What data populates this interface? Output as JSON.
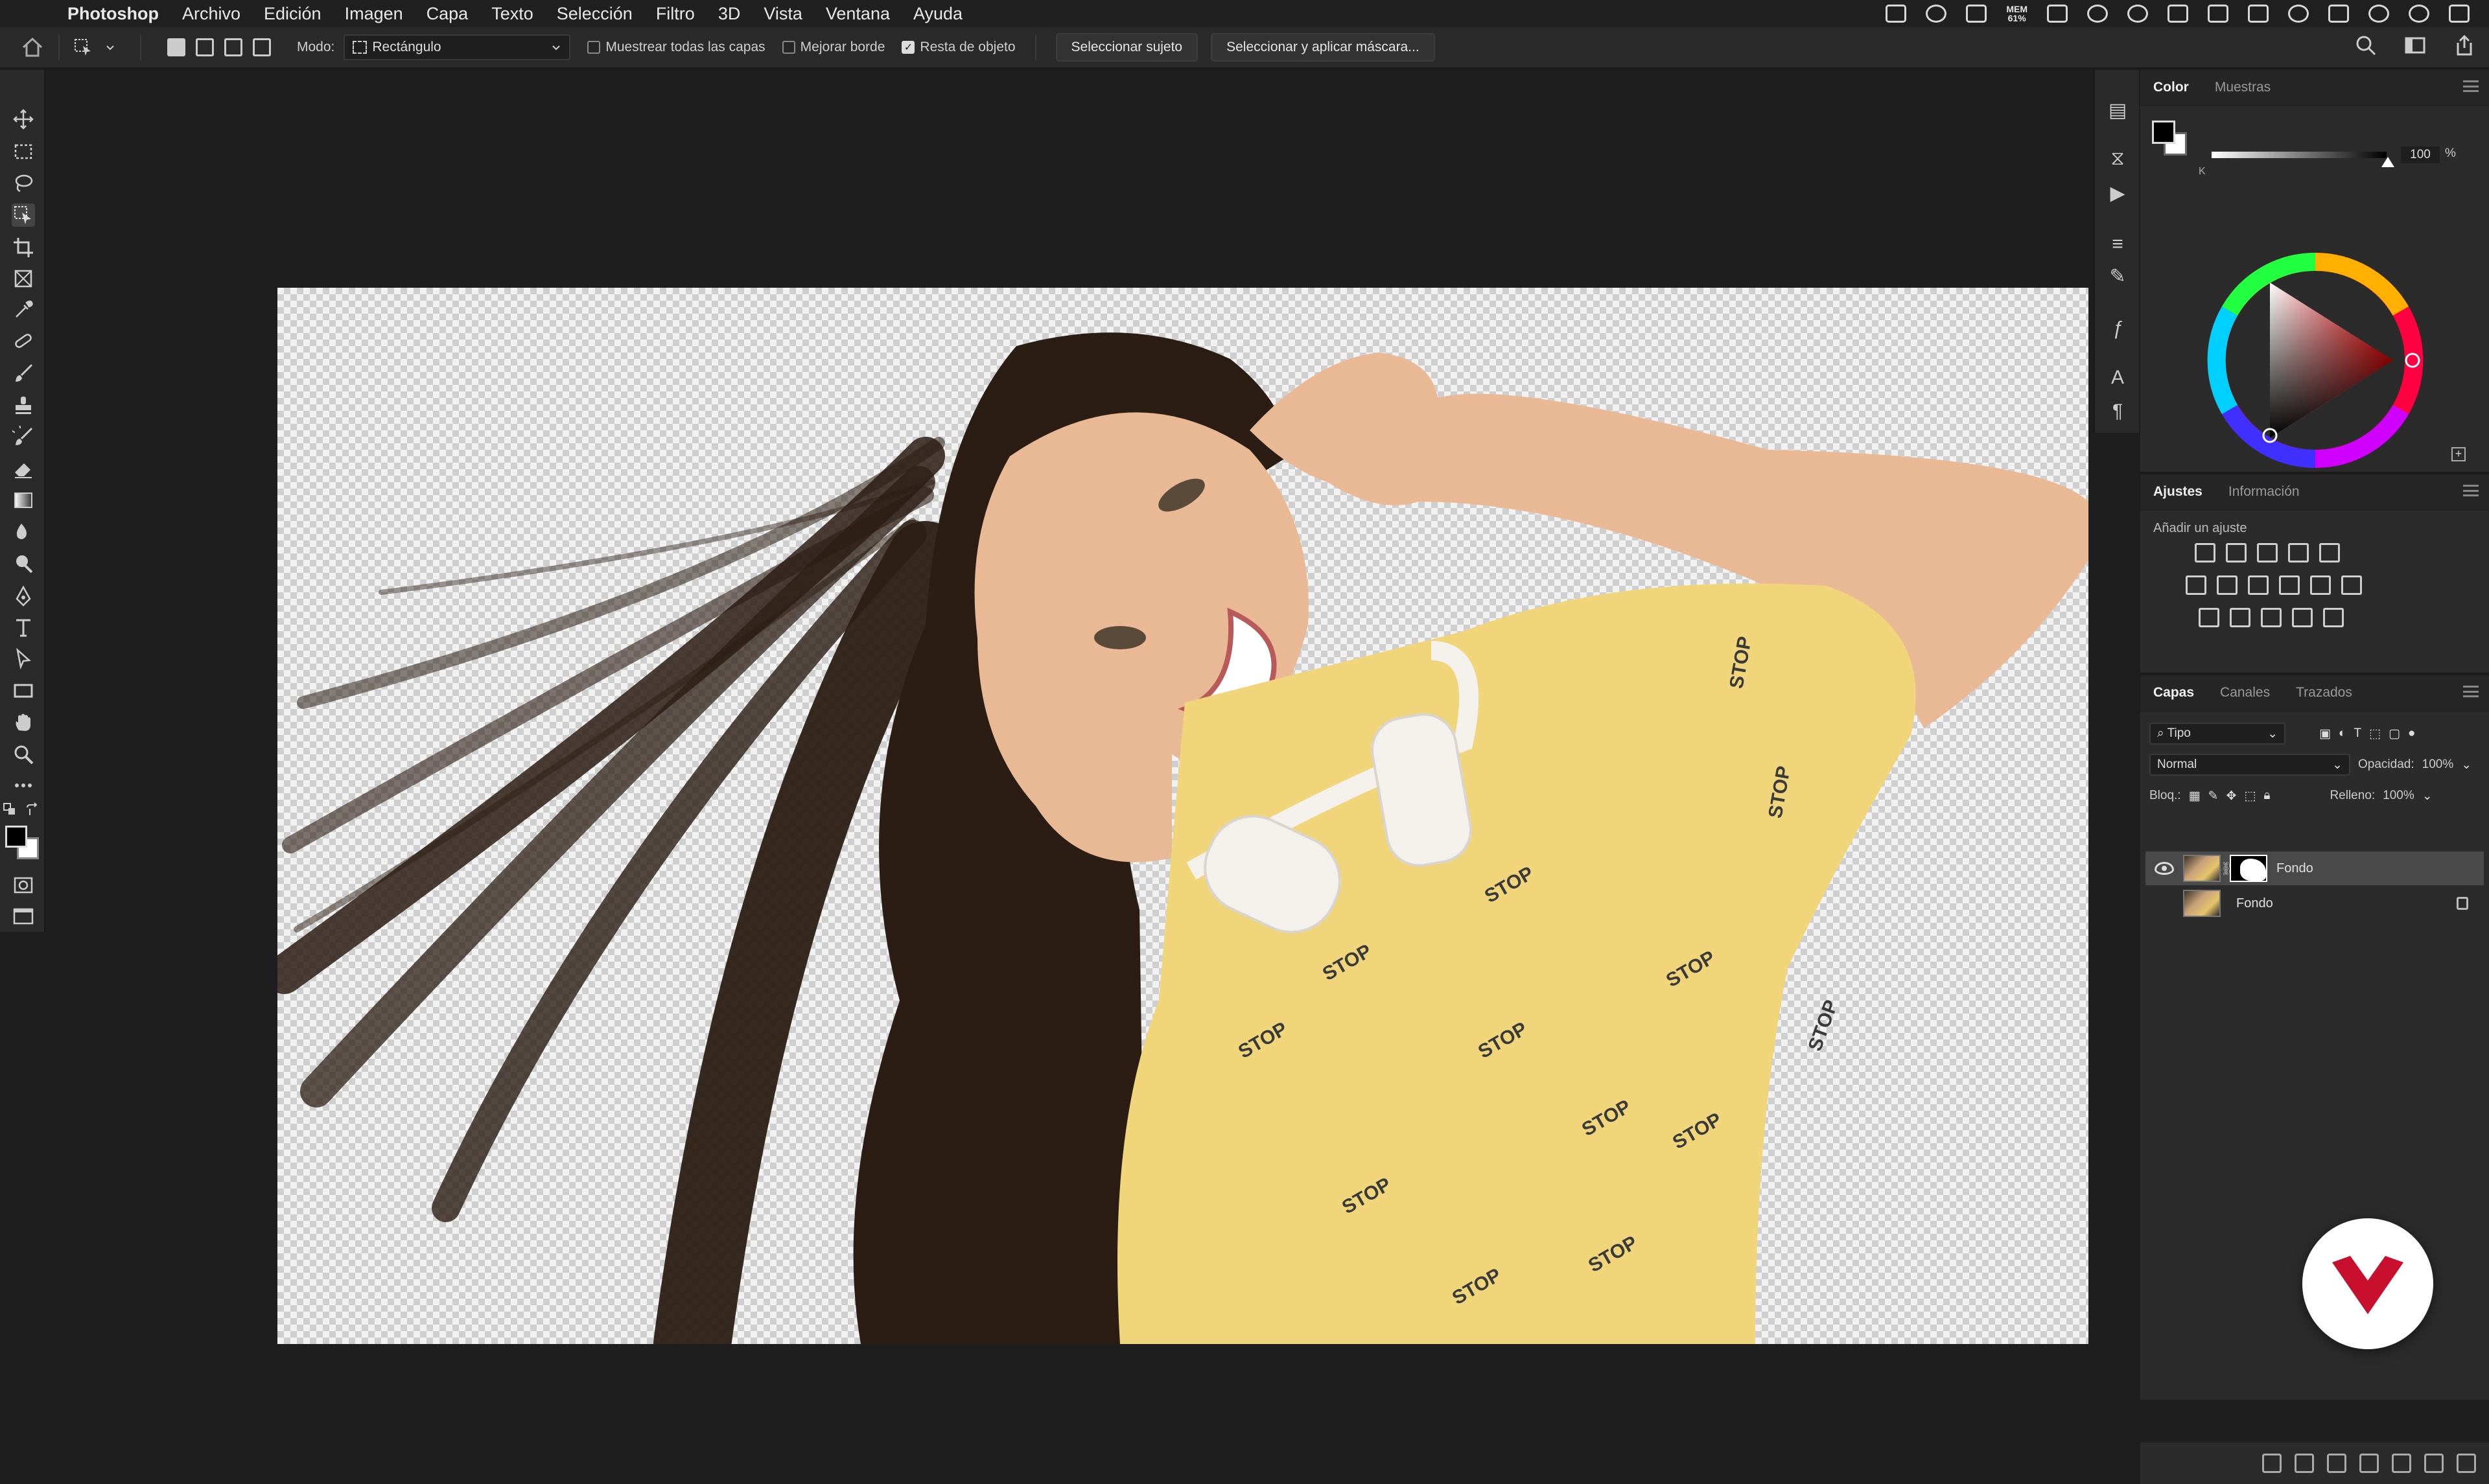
{
  "menubar": {
    "app_name": "Photoshop",
    "items": [
      "Archivo",
      "Edición",
      "Imagen",
      "Capa",
      "Texto",
      "Selección",
      "Filtro",
      "3D",
      "Vista",
      "Ventana",
      "Ayuda"
    ],
    "mem_label": "MEM",
    "mem_value": "61%"
  },
  "options": {
    "mode_label": "Modo:",
    "mode_value": "Rectángulo",
    "chk_sample_all": "Muestrear todas las capas",
    "chk_sample_all_on": false,
    "chk_enhance_edge": "Mejorar borde",
    "chk_enhance_edge_on": false,
    "chk_object_subtract": "Resta de objeto",
    "chk_object_subtract_on": true,
    "btn_select_subject": "Seleccionar sujeto",
    "btn_select_mask": "Seleccionar y aplicar máscara..."
  },
  "color_panel": {
    "tabs": [
      "Color",
      "Muestras"
    ],
    "channel_label": "K",
    "value": "100",
    "unit": "%"
  },
  "adjustments_panel": {
    "tabs": [
      "Ajustes",
      "Información"
    ],
    "subtitle": "Añadir un ajuste"
  },
  "layers_panel": {
    "tabs": [
      "Capas",
      "Canales",
      "Trazados"
    ],
    "filter": "Tipo",
    "blend_mode": "Normal",
    "opacity_label": "Opacidad:",
    "opacity": "100%",
    "lock_label": "Bloq.:",
    "fill_label": "Relleno:",
    "fill": "100%",
    "layers": [
      {
        "name": "Fondo",
        "visible": true,
        "selected": true,
        "has_mask": true,
        "locked": false
      },
      {
        "name": "Fondo",
        "visible": false,
        "selected": false,
        "has_mask": false,
        "locked": true
      }
    ]
  },
  "colors": {
    "menubar_bg": "#202020",
    "panel_bg": "#2b2b2b",
    "workspace_bg": "#1e1e1e",
    "shirt": "#f0d57a",
    "hair": "#2b1d14",
    "skin": "#e9b894",
    "badge_red": "#c8102e"
  }
}
